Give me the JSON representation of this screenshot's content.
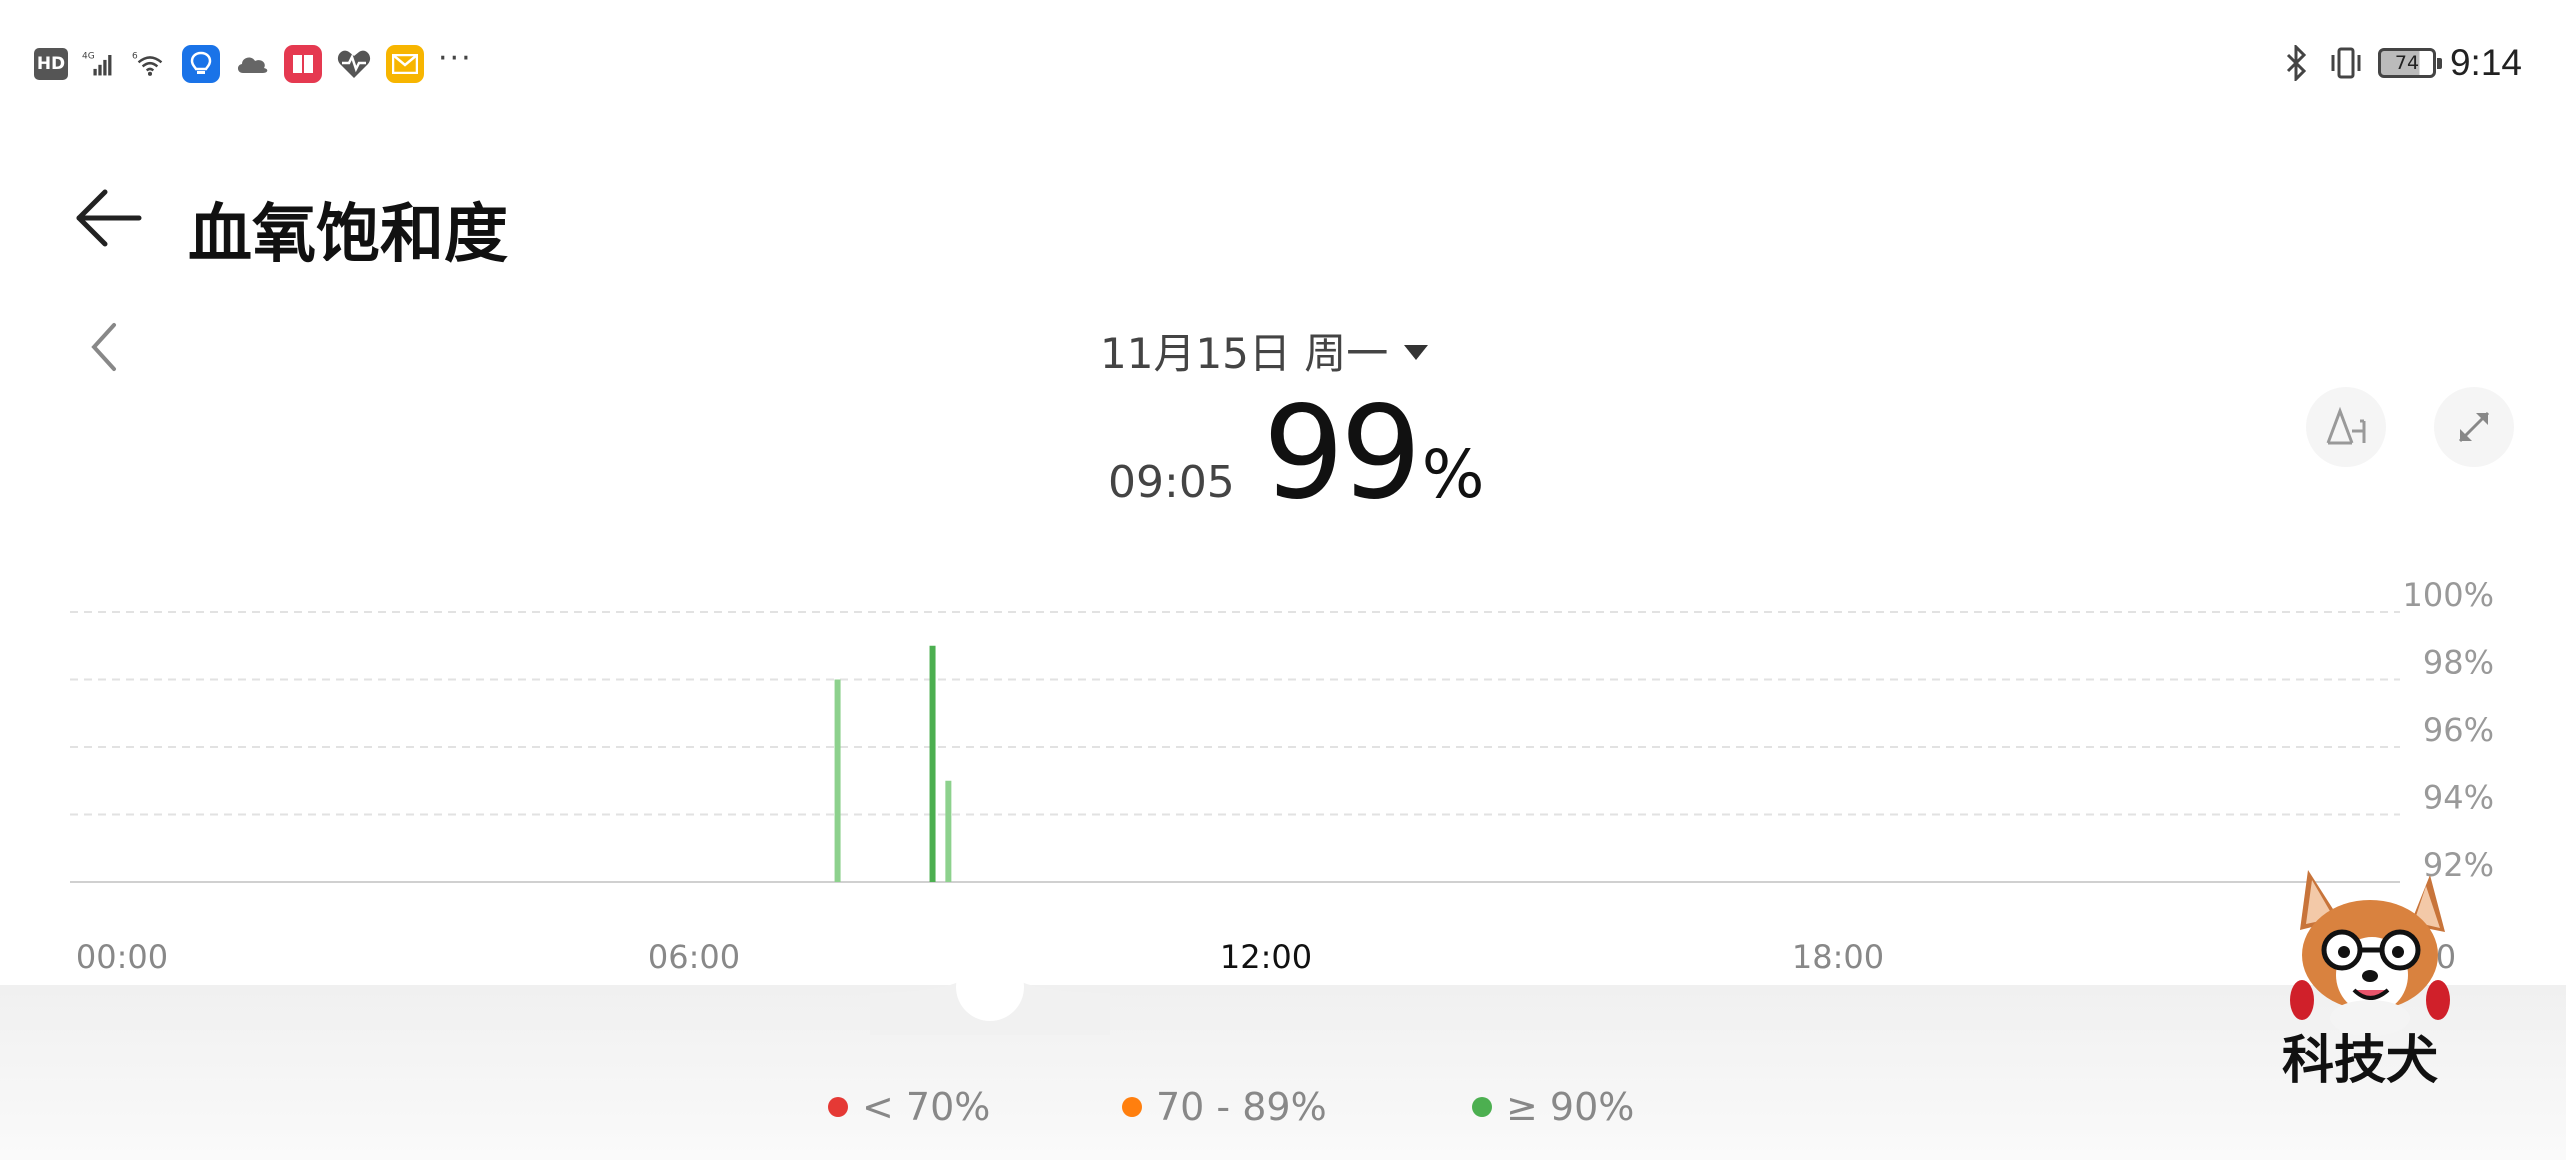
{
  "status_bar": {
    "hd": "HD",
    "network_label": "4G",
    "wifi_label": "6",
    "battery": "74",
    "time": "9:14"
  },
  "header": {
    "title": "血氧饱和度"
  },
  "date_selector": {
    "date": "11月15日 周一"
  },
  "reading": {
    "time": "09:05",
    "value": "99",
    "unit": "%"
  },
  "colors": {
    "green": "#4caf50",
    "green_light": "#8dd18d",
    "orange": "#ff7f0e",
    "red": "#e53935"
  },
  "chart_data": {
    "type": "bar",
    "x_axis": {
      "ticks": [
        "00:00",
        "06:00",
        "12:00",
        "18:00",
        "24:00"
      ],
      "highlighted_tick": "12:00"
    },
    "y_axis": {
      "ticks": [
        "100%",
        "98%",
        "96%",
        "94%",
        "92%"
      ],
      "range": [
        92,
        100
      ]
    },
    "series": [
      {
        "points": [
          {
            "time": "08:05",
            "value": 98
          },
          {
            "time": "09:15",
            "value": 95
          },
          {
            "time": "09:05",
            "value": 99
          }
        ]
      }
    ],
    "grid": true
  },
  "legend": [
    {
      "label": "< 70%",
      "color": "#e53935"
    },
    {
      "label": "70 - 89%",
      "color": "#ff7f0e"
    },
    {
      "label": "≥ 90%",
      "color": "#4caf50"
    }
  ],
  "watermark": {
    "text": "科技犬"
  }
}
